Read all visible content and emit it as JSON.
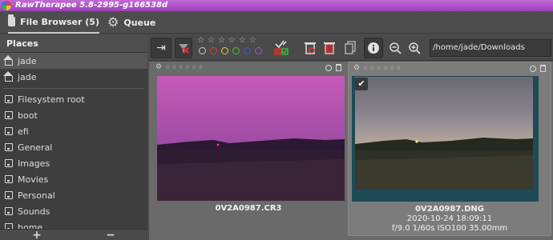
{
  "window": {
    "title": "RawTherapee 5.8-2995-g166538d"
  },
  "tabs": [
    {
      "label": "File Browser (5)",
      "icon": "folder-icon",
      "active": true
    },
    {
      "label": "Queue",
      "icon": "gear-icon",
      "active": false
    }
  ],
  "places": {
    "header": "Places",
    "items": [
      {
        "label": "jade",
        "icon": "home-icon",
        "selected": true
      },
      {
        "label": "jade",
        "icon": "home-icon",
        "selected": false
      },
      {
        "label": "Filesystem root",
        "icon": "drive-icon"
      },
      {
        "label": "boot",
        "icon": "drive-icon"
      },
      {
        "label": "efi",
        "icon": "drive-icon"
      },
      {
        "label": "General",
        "icon": "drive-icon"
      },
      {
        "label": "Images",
        "icon": "drive-icon"
      },
      {
        "label": "Movies",
        "icon": "drive-icon"
      },
      {
        "label": "Personal",
        "icon": "drive-icon"
      },
      {
        "label": "Sounds",
        "icon": "drive-icon"
      },
      {
        "label": "home",
        "icon": "drive-icon"
      }
    ],
    "add_label": "+",
    "remove_label": "−"
  },
  "toolbar": {
    "stars_row": "☆☆☆☆☆☆",
    "path": "/home/jade/Downloads",
    "color_labels": [
      "#c8c8c8",
      "#e03b3b",
      "#e6d23a",
      "#3cc53c",
      "#3a5fe0",
      "#b54ad6"
    ]
  },
  "thumbnails": [
    {
      "filename": "0V2A0987.CR3",
      "selected": false
    },
    {
      "filename": "0V2A0987.DNG",
      "date": "2020-10-24 18:09:11",
      "exif": "f/9.0 1/60s ISO100 35.00mm",
      "selected": true
    }
  ],
  "colors": {
    "title_bar": "#b556cc",
    "selection_border": "#1f4a57"
  }
}
